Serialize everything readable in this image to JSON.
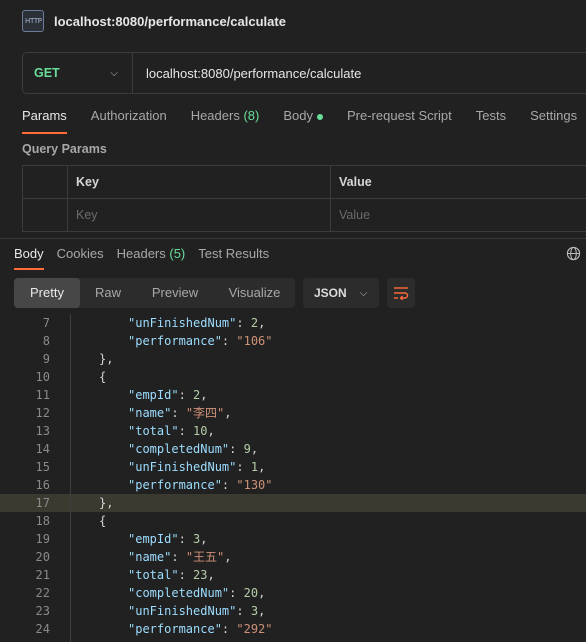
{
  "tab": {
    "icon_text": "HTTP",
    "title": "localhost:8080/performance/calculate"
  },
  "request": {
    "method": "GET",
    "url": "localhost:8080/performance/calculate"
  },
  "request_tabs": [
    {
      "label": "Params"
    },
    {
      "label": "Authorization"
    },
    {
      "label": "Headers",
      "count": "(8)"
    },
    {
      "label": "Body"
    },
    {
      "label": "Pre-request Script"
    },
    {
      "label": "Tests"
    },
    {
      "label": "Settings"
    }
  ],
  "query_params": {
    "title": "Query Params",
    "headers": {
      "key": "Key",
      "value": "Value"
    },
    "placeholders": {
      "key": "Key",
      "value": "Value"
    }
  },
  "response_tabs": [
    {
      "label": "Body"
    },
    {
      "label": "Cookies"
    },
    {
      "label": "Headers",
      "count": "(5)"
    },
    {
      "label": "Test Results"
    }
  ],
  "view_modes": [
    "Pretty",
    "Raw",
    "Preview",
    "Visualize"
  ],
  "format": "JSON",
  "code_lines": [
    {
      "n": "7",
      "t": "\"unFinishedNum\": 2,",
      "indent": 2
    },
    {
      "n": "8",
      "t": "\"performance\": \"106\"",
      "indent": 2
    },
    {
      "n": "9",
      "t": "},",
      "indent": 1
    },
    {
      "n": "10",
      "t": "{",
      "indent": 1
    },
    {
      "n": "11",
      "t": "\"empId\": 2,",
      "indent": 2
    },
    {
      "n": "12",
      "t": "\"name\": \"李四\",",
      "indent": 2
    },
    {
      "n": "13",
      "t": "\"total\": 10,",
      "indent": 2
    },
    {
      "n": "14",
      "t": "\"completedNum\": 9,",
      "indent": 2
    },
    {
      "n": "15",
      "t": "\"unFinishedNum\": 1,",
      "indent": 2
    },
    {
      "n": "16",
      "t": "\"performance\": \"130\"",
      "indent": 2
    },
    {
      "n": "17",
      "t": "},",
      "indent": 1,
      "highlight": true
    },
    {
      "n": "18",
      "t": "{",
      "indent": 1
    },
    {
      "n": "19",
      "t": "\"empId\": 3,",
      "indent": 2
    },
    {
      "n": "20",
      "t": "\"name\": \"王五\",",
      "indent": 2
    },
    {
      "n": "21",
      "t": "\"total\": 23,",
      "indent": 2
    },
    {
      "n": "22",
      "t": "\"completedNum\": 20,",
      "indent": 2
    },
    {
      "n": "23",
      "t": "\"unFinishedNum\": 3,",
      "indent": 2
    },
    {
      "n": "24",
      "t": "\"performance\": \"292\"",
      "indent": 2
    }
  ],
  "colors": {
    "accent": "#ff6c37",
    "method_get": "#6bdd9a",
    "json_key": "#9cdcfe",
    "json_string": "#ce9178",
    "json_number": "#b5cea8"
  }
}
